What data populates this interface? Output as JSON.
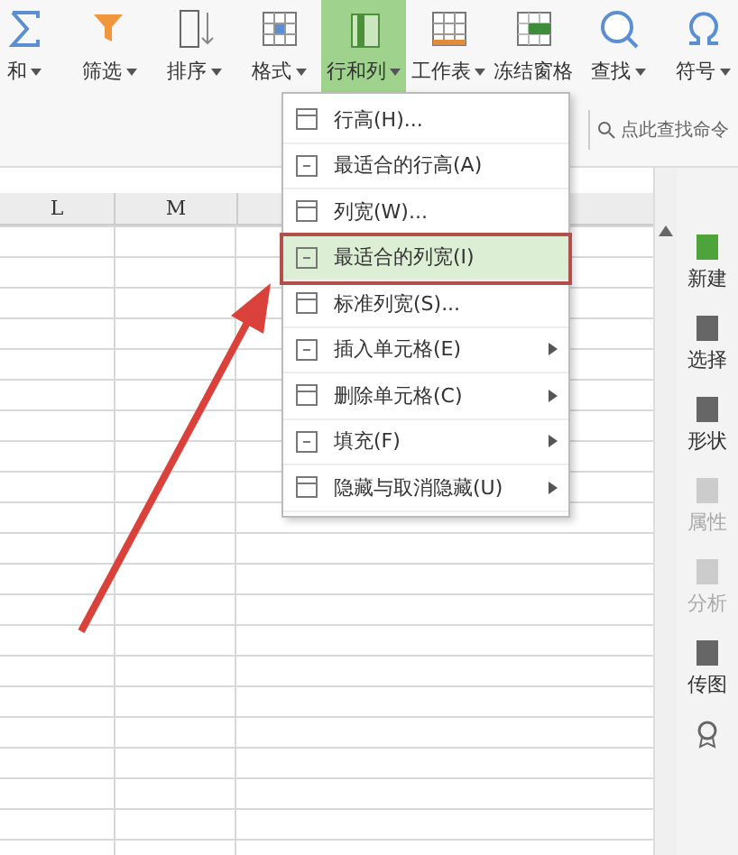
{
  "toolbar": [
    {
      "label": "和",
      "dropdown": true,
      "selected": false
    },
    {
      "label": "筛选",
      "dropdown": true,
      "selected": false
    },
    {
      "label": "排序",
      "dropdown": true,
      "selected": false
    },
    {
      "label": "格式",
      "dropdown": true,
      "selected": false
    },
    {
      "label": "行和列",
      "dropdown": true,
      "selected": true
    },
    {
      "label": "工作表",
      "dropdown": true,
      "selected": false
    },
    {
      "label": "冻结窗格",
      "dropdown": false,
      "selected": false
    },
    {
      "label": "查找",
      "dropdown": true,
      "selected": false
    },
    {
      "label": "符号",
      "dropdown": true,
      "selected": false
    }
  ],
  "search": {
    "placeholder": "点此查找命令"
  },
  "columns": [
    "L",
    "M"
  ],
  "menu": [
    {
      "label": "行高(H)...",
      "submenu": false,
      "highlighted": false
    },
    {
      "label": "最适合的行高(A)",
      "submenu": false,
      "highlighted": false
    },
    {
      "label": "列宽(W)...",
      "submenu": false,
      "highlighted": false
    },
    {
      "label": "最适合的列宽(I)",
      "submenu": false,
      "highlighted": true
    },
    {
      "label": "标准列宽(S)...",
      "submenu": false,
      "highlighted": false
    },
    {
      "label": "插入单元格(E)",
      "submenu": true,
      "highlighted": false
    },
    {
      "label": "删除单元格(C)",
      "submenu": true,
      "highlighted": false
    },
    {
      "label": "填充(F)",
      "submenu": true,
      "highlighted": false
    },
    {
      "label": "隐藏与取消隐藏(U)",
      "submenu": true,
      "highlighted": false
    }
  ],
  "sidebar": [
    {
      "label": "新建",
      "disabled": false
    },
    {
      "label": "选择",
      "disabled": false
    },
    {
      "label": "形状",
      "disabled": false
    },
    {
      "label": "属性",
      "disabled": true
    },
    {
      "label": "分析",
      "disabled": true
    },
    {
      "label": "传图",
      "disabled": false
    }
  ]
}
